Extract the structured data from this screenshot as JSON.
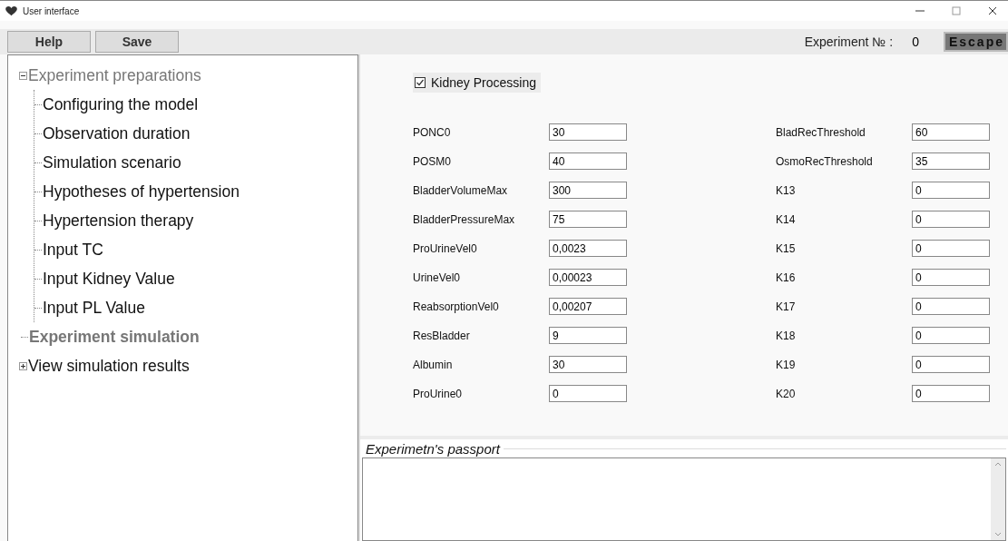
{
  "window": {
    "title": "User interface"
  },
  "toolbar": {
    "buttons": [
      "Help",
      "Save"
    ],
    "experiment_label": "Experiment № :",
    "experiment_number": "0",
    "escape_button": "Escape"
  },
  "tree": [
    {
      "label": "Experiment preparations",
      "expanded": true,
      "disabled": true,
      "selected": false,
      "children": [
        {
          "label": "Configuring the model"
        },
        {
          "label": "Observation duration"
        },
        {
          "label": "Simulation scenario"
        },
        {
          "label": "Hypotheses of hypertension"
        },
        {
          "label": "Hypertension therapy"
        },
        {
          "label": "Input TC"
        },
        {
          "label": "Input Kidney Value"
        },
        {
          "label": "Input PL Value"
        }
      ]
    },
    {
      "label": "Experiment simulation",
      "disabled": true,
      "selected": true
    },
    {
      "label": "View simulation results",
      "expanded": false,
      "disabled": false,
      "selected": false
    }
  ],
  "kidney_processing": {
    "label": "Kidney Processing",
    "checked": true
  },
  "parameters": [
    {
      "left": {
        "label": "PONC0",
        "value": "30"
      },
      "right": {
        "label": "BladRecThreshold",
        "value": "60"
      }
    },
    {
      "left": {
        "label": "POSM0",
        "value": "40"
      },
      "right": {
        "label": "OsmoRecThreshold",
        "value": "35"
      }
    },
    {
      "left": {
        "label": "BladderVolumeMax",
        "value": "300"
      },
      "right": {
        "label": "K13",
        "value": "0"
      }
    },
    {
      "left": {
        "label": "BladderPressureMax",
        "value": "75"
      },
      "right": {
        "label": "K14",
        "value": "0"
      }
    },
    {
      "left": {
        "label": "ProUrineVel0",
        "value": "0,0023"
      },
      "right": {
        "label": "K15",
        "value": "0"
      }
    },
    {
      "left": {
        "label": "UrineVel0",
        "value": "0,00023"
      },
      "right": {
        "label": "K16",
        "value": "0"
      }
    },
    {
      "left": {
        "label": "ReabsorptionVel0",
        "value": "0,00207"
      },
      "right": {
        "label": "K17",
        "value": "0"
      }
    },
    {
      "left": {
        "label": "ResBladder",
        "value": "9"
      },
      "right": {
        "label": "K18",
        "value": "0"
      }
    },
    {
      "left": {
        "label": "Albumin",
        "value": "30"
      },
      "right": {
        "label": "K19",
        "value": "0"
      }
    },
    {
      "left": {
        "label": "ProUrine0",
        "value": "0"
      },
      "right": {
        "label": "K20",
        "value": "0"
      }
    }
  ],
  "passport": {
    "title": "Experimetn's passport"
  }
}
